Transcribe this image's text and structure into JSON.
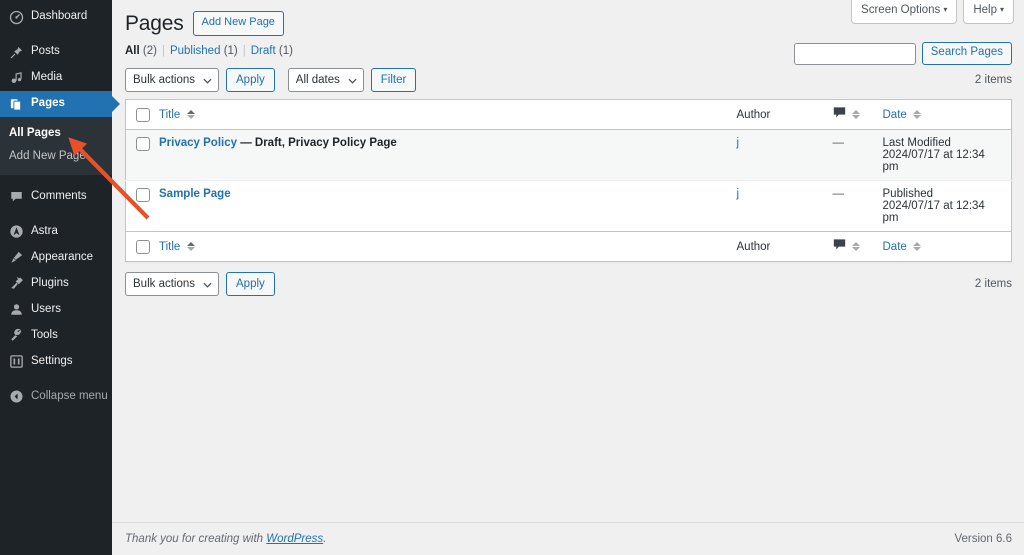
{
  "sidebar": {
    "items": [
      {
        "label": "Dashboard",
        "icon": "dashboard-icon",
        "name": "dashboard",
        "state": "normal"
      },
      {
        "label": "Posts",
        "icon": "pin-icon",
        "name": "posts",
        "state": "normal"
      },
      {
        "label": "Media",
        "icon": "media-icon",
        "name": "media",
        "state": "normal"
      },
      {
        "label": "Pages",
        "icon": "pages-icon",
        "name": "pages",
        "state": "active"
      },
      {
        "label": "Comments",
        "icon": "comment-icon",
        "name": "comments",
        "state": "normal"
      },
      {
        "label": "Astra",
        "icon": "astra-icon",
        "name": "astra",
        "state": "normal"
      },
      {
        "label": "Appearance",
        "icon": "brush-icon",
        "name": "appearance",
        "state": "normal"
      },
      {
        "label": "Plugins",
        "icon": "plug-icon",
        "name": "plugins",
        "state": "normal"
      },
      {
        "label": "Users",
        "icon": "user-icon",
        "name": "users",
        "state": "normal"
      },
      {
        "label": "Tools",
        "icon": "wrench-icon",
        "name": "tools",
        "state": "normal"
      },
      {
        "label": "Settings",
        "icon": "settings-icon",
        "name": "settings",
        "state": "normal"
      },
      {
        "label": "Collapse menu",
        "icon": "collapse-icon",
        "name": "collapse-menu",
        "state": "dim"
      }
    ],
    "submenu": {
      "items": [
        {
          "label": "All Pages",
          "current": true
        },
        {
          "label": "Add New Page",
          "current": false
        }
      ]
    },
    "colors": {
      "background": "#1d2327",
      "submenu_background": "#2c3338",
      "active": "#2271b1"
    }
  },
  "screen_meta": {
    "screen_options_label": "Screen Options",
    "help_label": "Help",
    "caret": "▾"
  },
  "header": {
    "title": "Pages",
    "add_new_label": "Add New Page"
  },
  "search": {
    "value": "",
    "placeholder": "",
    "submit_label": "Search Pages"
  },
  "filters": {
    "all": {
      "label": "All",
      "count": "(2)"
    },
    "published": {
      "label": "Published",
      "count": "(1)"
    },
    "draft": {
      "label": "Draft",
      "count": "(1)"
    },
    "separator": "|"
  },
  "tablenav_top": {
    "bulk_actions_label": "Bulk actions",
    "apply_label": "Apply",
    "dates_label": "All dates",
    "filter_label": "Filter",
    "displaying_num": "2 items",
    "select_caret": "⌄"
  },
  "tablenav_bottom": {
    "bulk_actions_label": "Bulk actions",
    "apply_label": "Apply",
    "displaying_num": "2 items"
  },
  "table": {
    "columns": {
      "title": "Title",
      "author": "Author",
      "comments": "comment-bubble-icon",
      "date": "Date"
    },
    "rows": [
      {
        "title": "Privacy Policy",
        "state_suffix": "— Draft, Privacy Policy Page",
        "author": "j",
        "comments": "—",
        "date_status": "Last Modified",
        "date_value": "2024/07/17 at 12:34 pm",
        "alternate": true
      },
      {
        "title": "Sample Page",
        "state_suffix": "",
        "author": "j",
        "comments": "—",
        "date_status": "Published",
        "date_value": "2024/07/17 at 12:34 pm",
        "alternate": false
      }
    ]
  },
  "footer": {
    "thanks_prefix": "Thank you for creating with ",
    "wordpress_link": "WordPress",
    "thanks_suffix": ".",
    "version": "Version 6.6"
  },
  "annotation": {
    "arrow_color": "#e8502a",
    "points_to": "Add New Page"
  }
}
